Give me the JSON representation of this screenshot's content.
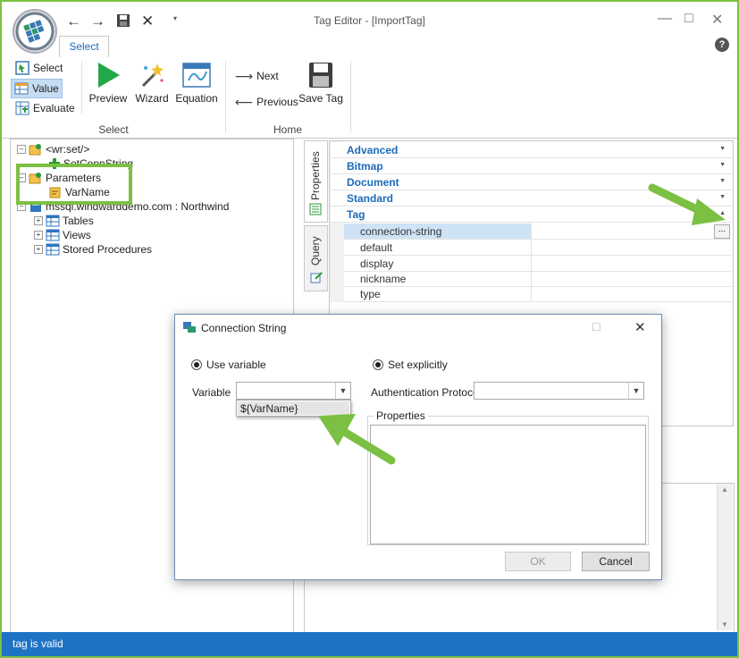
{
  "window": {
    "title": "Tag Editor - [ImportTag]"
  },
  "quick_access": {
    "back_icon": "arrow-left-icon",
    "forward_icon": "arrow-right-icon",
    "save_icon": "save-icon",
    "close_icon": "x-icon",
    "dropdown_icon": "caret-down-icon"
  },
  "tabs": [
    {
      "label": "Select"
    }
  ],
  "help_label": "?",
  "ribbon": {
    "mode_buttons": [
      {
        "label": "Select"
      },
      {
        "label": "Value"
      },
      {
        "label": "Evaluate"
      }
    ],
    "big_buttons": [
      {
        "label": "Preview"
      },
      {
        "label": "Wizard"
      },
      {
        "label": "Equation"
      }
    ],
    "group_select_label": "Select",
    "nav": {
      "next": "Next",
      "previous": "Previous"
    },
    "save_tag": "Save Tag",
    "group_home_label": "Home"
  },
  "tree": {
    "root": "<wr:set/>",
    "set_conn": "SetConnString",
    "parameters": "Parameters",
    "varname": "VarName",
    "datasource": "mssql.windwarddemo.com : Northwind",
    "children": [
      "Tables",
      "Views",
      "Stored Procedures"
    ]
  },
  "side_tabs": {
    "properties": "Properties",
    "query": "Query"
  },
  "properties": {
    "categories": [
      "Advanced",
      "Bitmap",
      "Document",
      "Standard",
      "Tag"
    ],
    "rows": [
      "connection-string",
      "default",
      "display",
      "nickname",
      "type"
    ],
    "ellipsis": "..."
  },
  "dialog": {
    "title": "Connection String",
    "use_variable": "Use variable",
    "set_explicitly": "Set explicitly",
    "variable_label": "Variable",
    "variable_value": "",
    "dropdown_option": "${VarName}",
    "auth_label": "Authentication Protocol",
    "auth_value": "",
    "properties_group": "Properties",
    "ok": "OK",
    "cancel": "Cancel"
  },
  "status": {
    "text": "tag is valid"
  },
  "colors": {
    "accent": "#1d6ab8",
    "highlight": "#7bc043",
    "status_bar": "#1f73c4"
  }
}
